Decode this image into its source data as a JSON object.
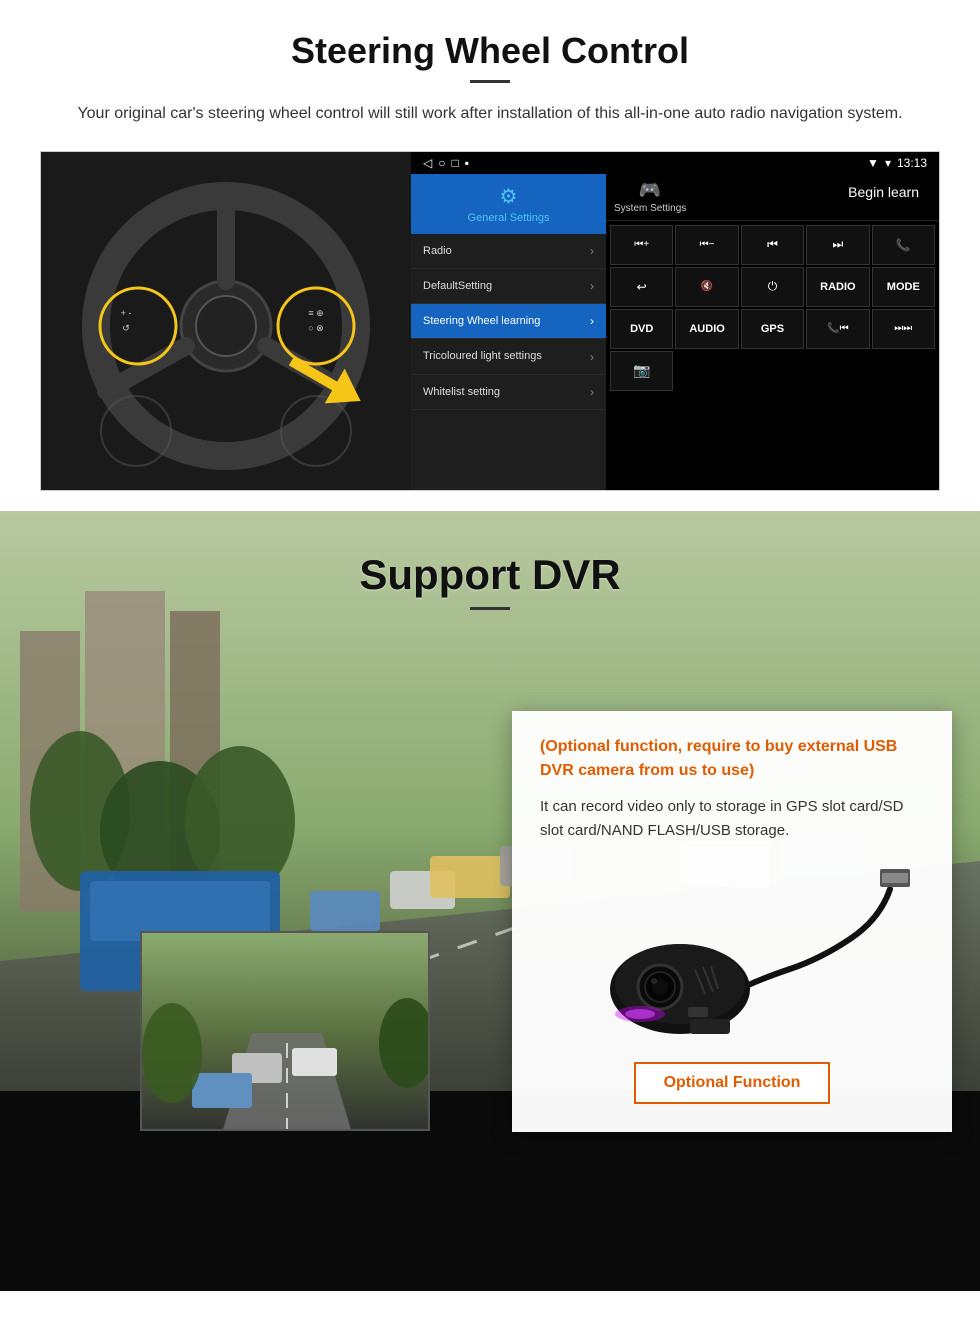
{
  "steering": {
    "title": "Steering Wheel Control",
    "subtitle": "Your original car's steering wheel control will still work after installation of this all-in-one auto radio navigation system.",
    "statusbar": {
      "signal": "▼",
      "wifi": "▾",
      "time": "13:13"
    },
    "navbar": {
      "back": "◁",
      "home": "○",
      "recents": "□",
      "menu": "▪"
    },
    "general_settings_label": "General Settings",
    "system_settings_label": "System Settings",
    "menu_items": [
      {
        "label": "Radio",
        "active": false
      },
      {
        "label": "DefaultSetting",
        "active": false
      },
      {
        "label": "Steering Wheel learning",
        "active": true
      },
      {
        "label": "Tricoloured light settings",
        "active": false
      },
      {
        "label": "Whitelist setting",
        "active": false
      }
    ],
    "begin_learn": "Begin learn",
    "control_buttons": [
      "⏮+",
      "⏮-",
      "⏮",
      "⏭",
      "📞",
      "↩",
      "🔇",
      "⏻",
      "RADIO",
      "MODE",
      "DVD",
      "AUDIO",
      "GPS",
      "📞⏮",
      "⏭⏭",
      "📷"
    ]
  },
  "dvr": {
    "title": "Support DVR",
    "info_title": "(Optional function, require to buy external USB DVR camera from us to use)",
    "info_text": "It can record video only to storage in GPS slot card/SD slot card/NAND FLASH/USB storage.",
    "optional_button_label": "Optional Function"
  }
}
